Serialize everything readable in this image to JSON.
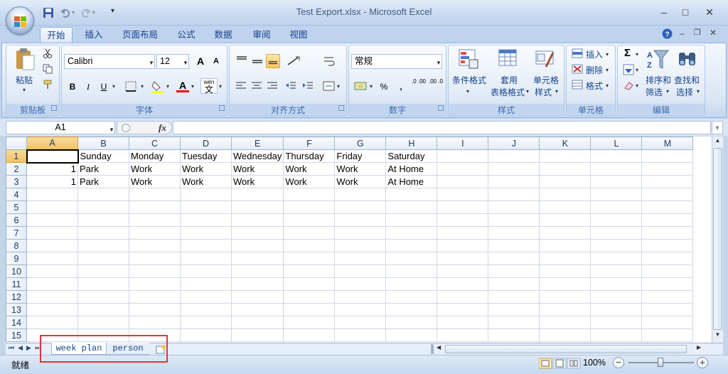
{
  "window": {
    "title": "Test Export.xlsx - Microsoft Excel",
    "minimize": "–",
    "maximize": "□",
    "close": "✕"
  },
  "qat": {
    "more": "▾"
  },
  "tabs": [
    {
      "label": "开始",
      "active": true
    },
    {
      "label": "插入"
    },
    {
      "label": "页面布局"
    },
    {
      "label": "公式"
    },
    {
      "label": "数据"
    },
    {
      "label": "审阅"
    },
    {
      "label": "视图"
    }
  ],
  "ribbon": {
    "clipboard": {
      "paste": "粘贴",
      "group": "剪贴板"
    },
    "font": {
      "name": "Calibri",
      "size": "12",
      "group": "字体",
      "bold": "B",
      "italic": "I",
      "underline": "U",
      "phonetic": "wén",
      "phonetic_char": "文",
      "grow": "A",
      "shrink": "A",
      "color_letter": "A"
    },
    "alignment": {
      "group": "对齐方式"
    },
    "number": {
      "format": "常规",
      "group": "数字",
      "percent": "%",
      "comma": ",",
      "inc": ".0 .00",
      "dec": ".00 .0"
    },
    "styles": {
      "conditional": "条件格式",
      "table_1": "套用",
      "table_2": "表格格式",
      "cell_1": "单元格",
      "cell_2": "样式",
      "group": "样式"
    },
    "cells": {
      "insert": "插入",
      "delete": "删除",
      "format": "格式",
      "group": "单元格"
    },
    "editing": {
      "sigma": "Σ",
      "sort_1": "排序和",
      "sort_2": "筛选",
      "find_1": "查找和",
      "find_2": "选择",
      "group": "编辑"
    }
  },
  "formula_bar": {
    "name_box": "A1",
    "fx": "fx",
    "value": ""
  },
  "grid": {
    "columns": [
      "A",
      "B",
      "C",
      "D",
      "E",
      "F",
      "G",
      "H",
      "I",
      "J",
      "K",
      "L",
      "M"
    ],
    "rows": [
      {
        "n": "1",
        "cells": [
          "",
          "Sunday",
          "Monday",
          "Tuesday",
          "Wednesday",
          "Thursday",
          "Friday",
          "Saturday",
          "",
          "",
          "",
          "",
          ""
        ]
      },
      {
        "n": "2",
        "cells": [
          "1",
          "Park",
          "Work",
          "Work",
          "Work",
          "Work",
          "Work",
          "At Home",
          "",
          "",
          "",
          "",
          ""
        ]
      },
      {
        "n": "3",
        "cells": [
          "1",
          "Park",
          "Work",
          "Work",
          "Work",
          "Work",
          "Work",
          "At Home",
          "",
          "",
          "",
          "",
          ""
        ]
      },
      {
        "n": "4",
        "cells": [
          "",
          "",
          "",
          "",
          "",
          "",
          "",
          "",
          "",
          "",
          "",
          "",
          ""
        ]
      },
      {
        "n": "5",
        "cells": [
          "",
          "",
          "",
          "",
          "",
          "",
          "",
          "",
          "",
          "",
          "",
          "",
          ""
        ]
      },
      {
        "n": "6",
        "cells": [
          "",
          "",
          "",
          "",
          "",
          "",
          "",
          "",
          "",
          "",
          "",
          "",
          ""
        ]
      },
      {
        "n": "7",
        "cells": [
          "",
          "",
          "",
          "",
          "",
          "",
          "",
          "",
          "",
          "",
          "",
          "",
          ""
        ]
      },
      {
        "n": "8",
        "cells": [
          "",
          "",
          "",
          "",
          "",
          "",
          "",
          "",
          "",
          "",
          "",
          "",
          ""
        ]
      },
      {
        "n": "9",
        "cells": [
          "",
          "",
          "",
          "",
          "",
          "",
          "",
          "",
          "",
          "",
          "",
          "",
          ""
        ]
      },
      {
        "n": "10",
        "cells": [
          "",
          "",
          "",
          "",
          "",
          "",
          "",
          "",
          "",
          "",
          "",
          "",
          ""
        ]
      },
      {
        "n": "11",
        "cells": [
          "",
          "",
          "",
          "",
          "",
          "",
          "",
          "",
          "",
          "",
          "",
          "",
          ""
        ]
      },
      {
        "n": "12",
        "cells": [
          "",
          "",
          "",
          "",
          "",
          "",
          "",
          "",
          "",
          "",
          "",
          "",
          ""
        ]
      },
      {
        "n": "13",
        "cells": [
          "",
          "",
          "",
          "",
          "",
          "",
          "",
          "",
          "",
          "",
          "",
          "",
          ""
        ]
      },
      {
        "n": "14",
        "cells": [
          "",
          "",
          "",
          "",
          "",
          "",
          "",
          "",
          "",
          "",
          "",
          "",
          ""
        ]
      },
      {
        "n": "15",
        "cells": [
          "",
          "",
          "",
          "",
          "",
          "",
          "",
          "",
          "",
          "",
          "",
          "",
          ""
        ]
      }
    ]
  },
  "sheets": [
    {
      "label": "week plan",
      "active": true
    },
    {
      "label": "person"
    }
  ],
  "status": {
    "ready": "就绪",
    "zoom": "100%",
    "zoom_out": "−",
    "zoom_in": "+"
  },
  "colors": {
    "highlight_red": "#e0363b",
    "fill_yellow": "#ffff00",
    "font_red": "#ff0000"
  }
}
